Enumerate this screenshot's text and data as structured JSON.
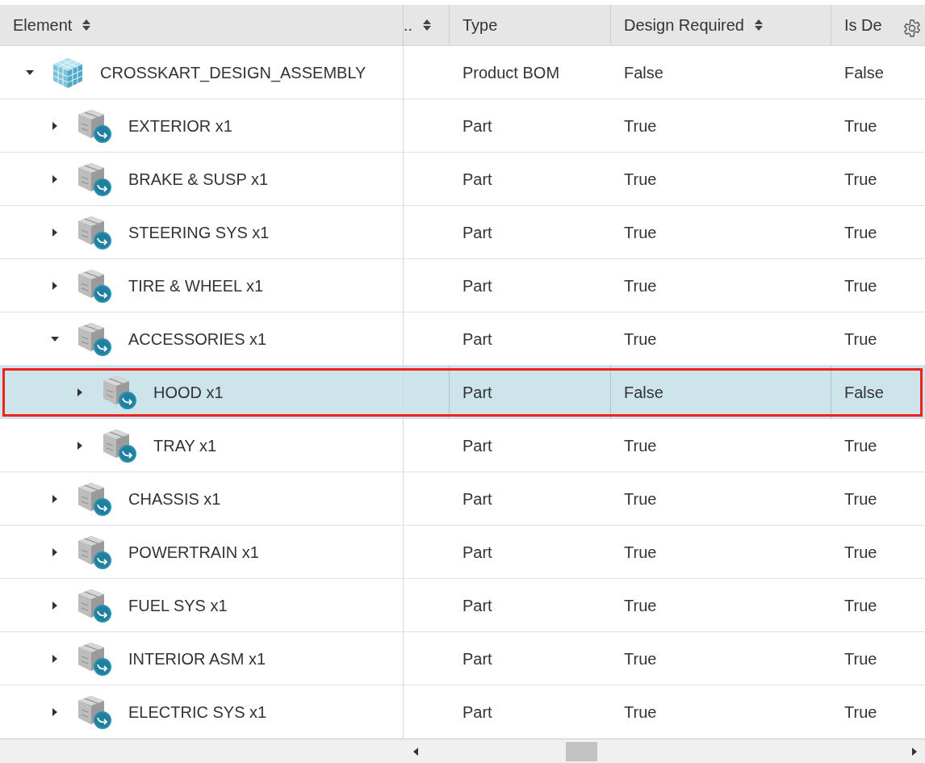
{
  "columns": [
    {
      "label": "Element",
      "sortable": true
    },
    {
      "label": "..",
      "sortable": true
    },
    {
      "label": "Type",
      "sortable": false
    },
    {
      "label": "Design Required",
      "sortable": true
    },
    {
      "label": "Is De",
      "sortable": false,
      "settings": true
    }
  ],
  "tree": [
    {
      "name": "CROSSKART_DESIGN_ASSEMBLY",
      "kind": "assembly",
      "expanded": true,
      "selected": false,
      "type": "Product BOM",
      "design_required": "False",
      "is_de": "False",
      "children": [
        {
          "name": "EXTERIOR x1",
          "kind": "part",
          "expanded": false,
          "selected": false,
          "type": "Part",
          "design_required": "True",
          "is_de": "True"
        },
        {
          "name": "BRAKE & SUSP x1",
          "kind": "part",
          "expanded": false,
          "selected": false,
          "type": "Part",
          "design_required": "True",
          "is_de": "True"
        },
        {
          "name": "STEERING SYS x1",
          "kind": "part",
          "expanded": false,
          "selected": false,
          "type": "Part",
          "design_required": "True",
          "is_de": "True"
        },
        {
          "name": "TIRE & WHEEL x1",
          "kind": "part",
          "expanded": false,
          "selected": false,
          "type": "Part",
          "design_required": "True",
          "is_de": "True"
        },
        {
          "name": "ACCESSORIES x1",
          "kind": "part",
          "expanded": true,
          "selected": false,
          "type": "Part",
          "design_required": "True",
          "is_de": "True",
          "children": [
            {
              "name": "HOOD x1",
              "kind": "part",
              "expanded": false,
              "selected": true,
              "type": "Part",
              "design_required": "False",
              "is_de": "False"
            },
            {
              "name": "TRAY x1",
              "kind": "part",
              "expanded": false,
              "selected": false,
              "type": "Part",
              "design_required": "True",
              "is_de": "True"
            }
          ]
        },
        {
          "name": "CHASSIS x1",
          "kind": "part",
          "expanded": false,
          "selected": false,
          "type": "Part",
          "design_required": "True",
          "is_de": "True"
        },
        {
          "name": "POWERTRAIN x1",
          "kind": "part",
          "expanded": false,
          "selected": false,
          "type": "Part",
          "design_required": "True",
          "is_de": "True"
        },
        {
          "name": "FUEL SYS x1",
          "kind": "part",
          "expanded": false,
          "selected": false,
          "type": "Part",
          "design_required": "True",
          "is_de": "True"
        },
        {
          "name": "INTERIOR ASM x1",
          "kind": "part",
          "expanded": false,
          "selected": false,
          "type": "Part",
          "design_required": "True",
          "is_de": "True"
        },
        {
          "name": "ELECTRIC SYS x1",
          "kind": "part",
          "expanded": false,
          "selected": false,
          "type": "Part",
          "design_required": "True",
          "is_de": "True"
        }
      ]
    }
  ]
}
